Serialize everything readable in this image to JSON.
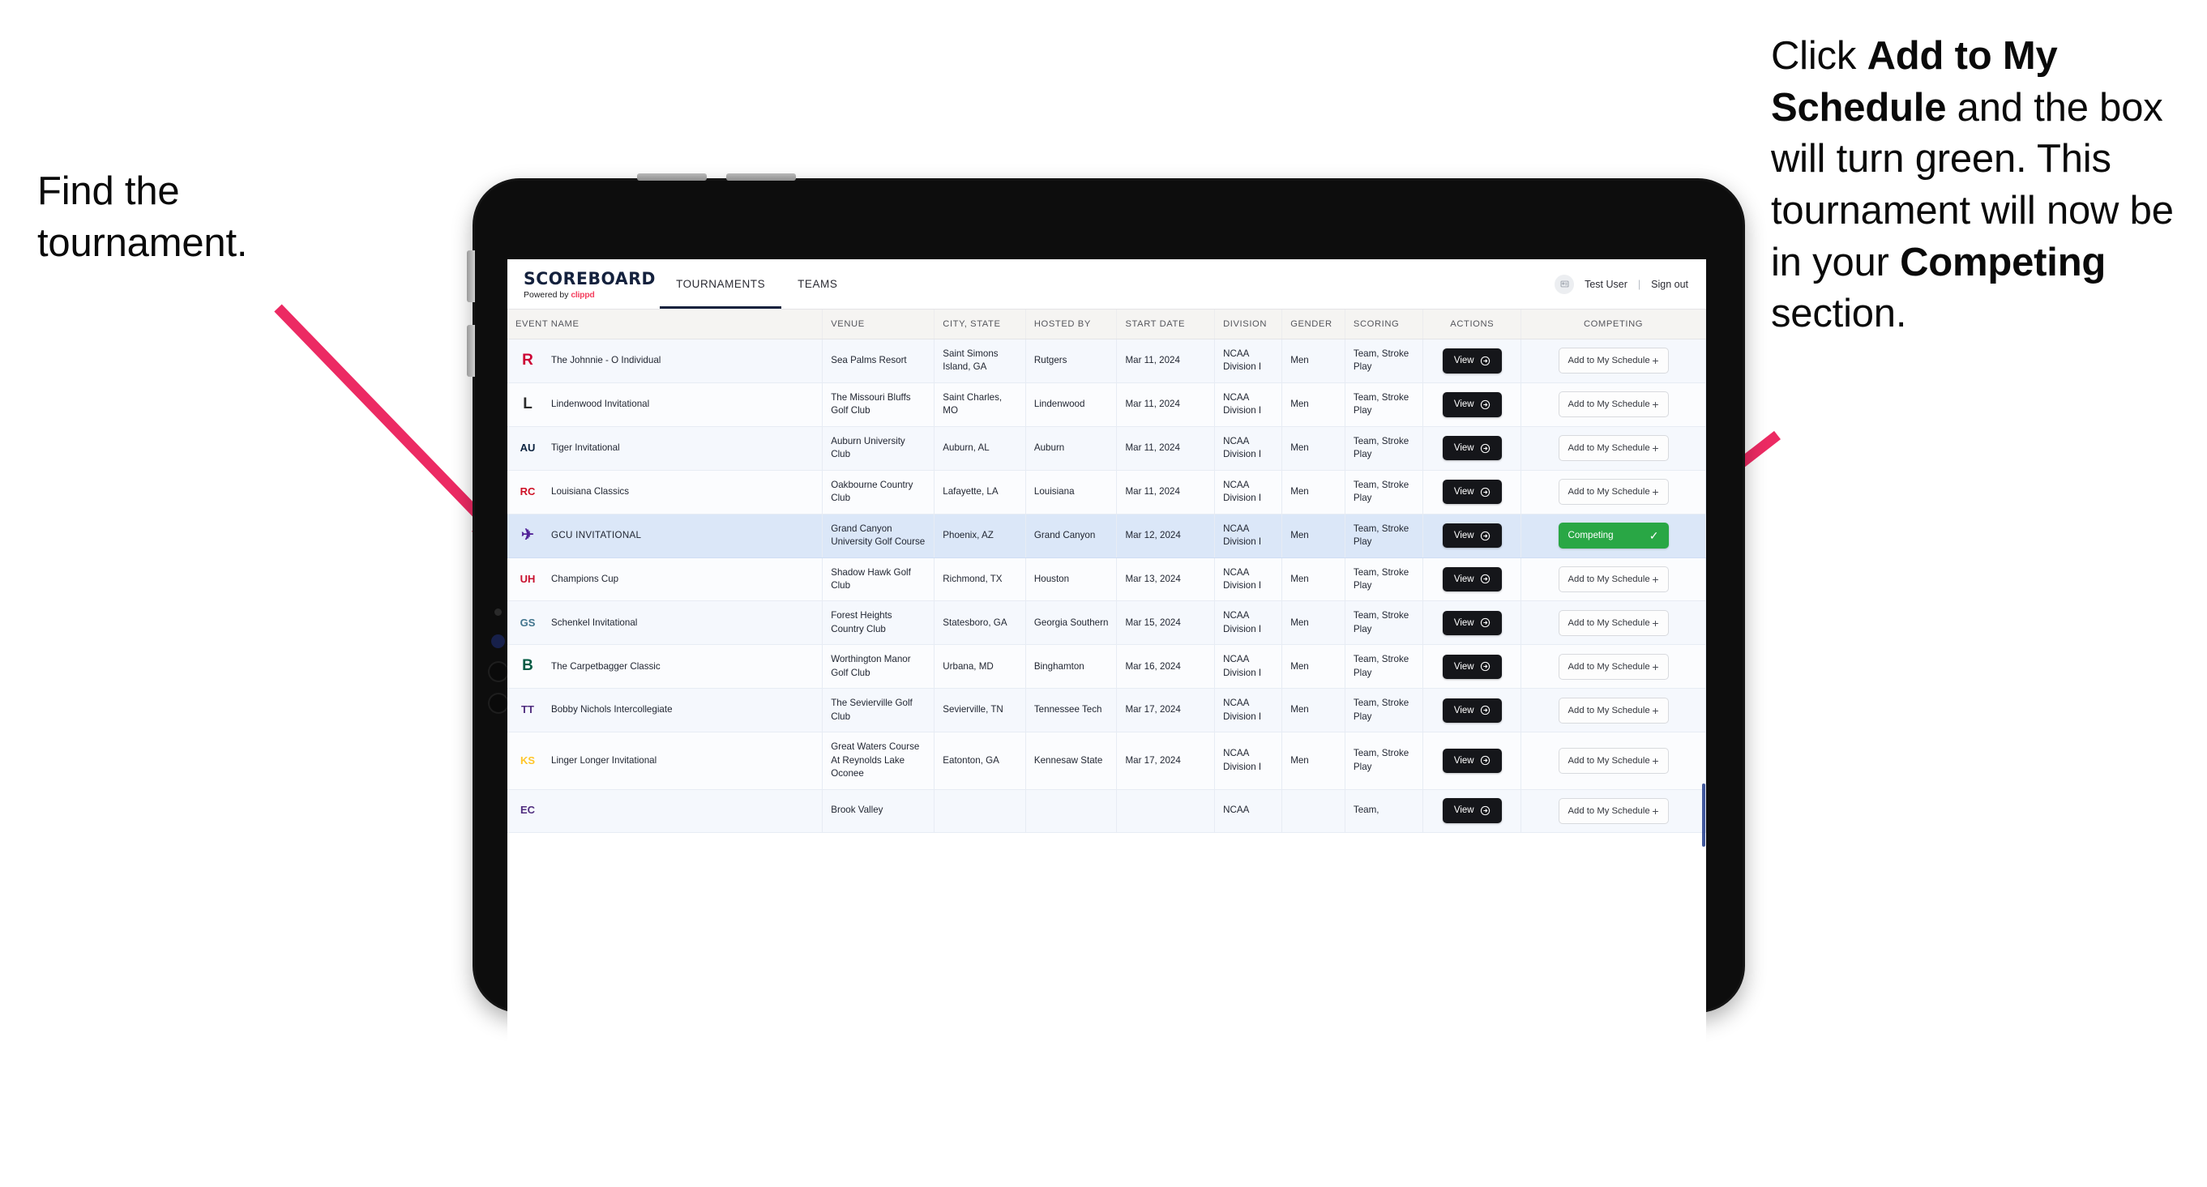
{
  "annotations": {
    "left": {
      "line1": "Find the",
      "line2": "tournament."
    },
    "right": {
      "t1": "Click ",
      "b1": "Add to My Schedule",
      "t2": " and the box will turn green. This tournament will now be in your ",
      "b2": "Competing",
      "t3": " section."
    },
    "arrow_color": "#ec2a63"
  },
  "app": {
    "brand": {
      "title": "SCOREBOARD",
      "powered_prefix": "Powered by ",
      "powered_brand": "clippd"
    },
    "nav": [
      {
        "label": "TOURNAMENTS",
        "active": true
      },
      {
        "label": "TEAMS",
        "active": false
      }
    ],
    "header_right": {
      "avatar_icon": "user-card-icon",
      "user": "Test User",
      "separator": "|",
      "signout": "Sign out"
    },
    "columns": [
      "EVENT NAME",
      "VENUE",
      "CITY, STATE",
      "HOSTED BY",
      "START DATE",
      "DIVISION",
      "GENDER",
      "SCORING",
      "ACTIONS",
      "COMPETING"
    ],
    "labels": {
      "view": "View",
      "add": "Add to My Schedule",
      "plus": "+",
      "competing": "Competing",
      "check": "✓"
    },
    "colors": {
      "competing_green": "#29a745",
      "view_black": "#15161a",
      "selected_row": "#dbe7f8",
      "row": "#f5f8fd",
      "brand_navy": "#14213d",
      "clippd_pink": "#f43f5e"
    },
    "rows": [
      {
        "logo": "rutgers-logo",
        "logo_text": "R",
        "logo_color": "#cc0033",
        "event": "The Johnnie - O Individual",
        "venue": "Sea Palms Resort",
        "city": "Saint Simons Island, GA",
        "host": "Rutgers",
        "date": "Mar 11, 2024",
        "division": "NCAA Division I",
        "gender": "Men",
        "scoring": "Team, Stroke Play",
        "competing": false
      },
      {
        "logo": "lindenwood-logo",
        "logo_text": "L",
        "logo_color": "#2b2b2b",
        "event": "Lindenwood Invitational",
        "venue": "The Missouri Bluffs Golf Club",
        "city": "Saint Charles, MO",
        "host": "Lindenwood",
        "date": "Mar 11, 2024",
        "division": "NCAA Division I",
        "gender": "Men",
        "scoring": "Team, Stroke Play",
        "competing": false
      },
      {
        "logo": "auburn-logo",
        "logo_text": "AU",
        "logo_color": "#0c2340",
        "event": "Tiger Invitational",
        "venue": "Auburn University Club",
        "city": "Auburn, AL",
        "host": "Auburn",
        "date": "Mar 11, 2024",
        "division": "NCAA Division I",
        "gender": "Men",
        "scoring": "Team, Stroke Play",
        "competing": false
      },
      {
        "logo": "louisiana-logo",
        "logo_text": "RC",
        "logo_color": "#ce1126",
        "event": "Louisiana Classics",
        "venue": "Oakbourne Country Club",
        "city": "Lafayette, LA",
        "host": "Louisiana",
        "date": "Mar 11, 2024",
        "division": "NCAA Division I",
        "gender": "Men",
        "scoring": "Team, Stroke Play",
        "competing": false
      },
      {
        "logo": "gcu-logo",
        "logo_text": "✈",
        "logo_color": "#522398",
        "event": "GCU INVITATIONAL",
        "venue": "Grand Canyon University Golf Course",
        "city": "Phoenix, AZ",
        "host": "Grand Canyon",
        "date": "Mar 12, 2024",
        "division": "NCAA Division I",
        "gender": "Men",
        "scoring": "Team, Stroke Play",
        "competing": true
      },
      {
        "logo": "houston-logo",
        "logo_text": "UH",
        "logo_color": "#c8102e",
        "event": "Champions Cup",
        "venue": "Shadow Hawk Golf Club",
        "city": "Richmond, TX",
        "host": "Houston",
        "date": "Mar 13, 2024",
        "division": "NCAA Division I",
        "gender": "Men",
        "scoring": "Team, Stroke Play",
        "competing": false
      },
      {
        "logo": "georgia-southern-logo",
        "logo_text": "GS",
        "logo_color": "#41748d",
        "event": "Schenkel Invitational",
        "venue": "Forest Heights Country Club",
        "city": "Statesboro, GA",
        "host": "Georgia Southern",
        "date": "Mar 15, 2024",
        "division": "NCAA Division I",
        "gender": "Men",
        "scoring": "Team, Stroke Play",
        "competing": false
      },
      {
        "logo": "binghamton-logo",
        "logo_text": "B",
        "logo_color": "#005a43",
        "event": "The Carpetbagger Classic",
        "venue": "Worthington Manor Golf Club",
        "city": "Urbana, MD",
        "host": "Binghamton",
        "date": "Mar 16, 2024",
        "division": "NCAA Division I",
        "gender": "Men",
        "scoring": "Team, Stroke Play",
        "competing": false
      },
      {
        "logo": "tennessee-tech-logo",
        "logo_text": "TT",
        "logo_color": "#4f2d7f",
        "event": "Bobby Nichols Intercollegiate",
        "venue": "The Sevierville Golf Club",
        "city": "Sevierville, TN",
        "host": "Tennessee Tech",
        "date": "Mar 17, 2024",
        "division": "NCAA Division I",
        "gender": "Men",
        "scoring": "Team, Stroke Play",
        "competing": false
      },
      {
        "logo": "kennesaw-state-logo",
        "logo_text": "KS",
        "logo_color": "#ffc629",
        "event": "Linger Longer Invitational",
        "venue": "Great Waters Course At Reynolds Lake Oconee",
        "city": "Eatonton, GA",
        "host": "Kennesaw State",
        "date": "Mar 17, 2024",
        "division": "NCAA Division I",
        "gender": "Men",
        "scoring": "Team, Stroke Play",
        "competing": false
      },
      {
        "logo": "east-carolina-logo",
        "logo_text": "EC",
        "logo_color": "#4f2d7f",
        "event": "",
        "venue": "Brook Valley",
        "city": "",
        "host": "",
        "date": "",
        "division": "NCAA",
        "gender": "",
        "scoring": "Team,",
        "competing": false,
        "clipped": true
      }
    ]
  }
}
